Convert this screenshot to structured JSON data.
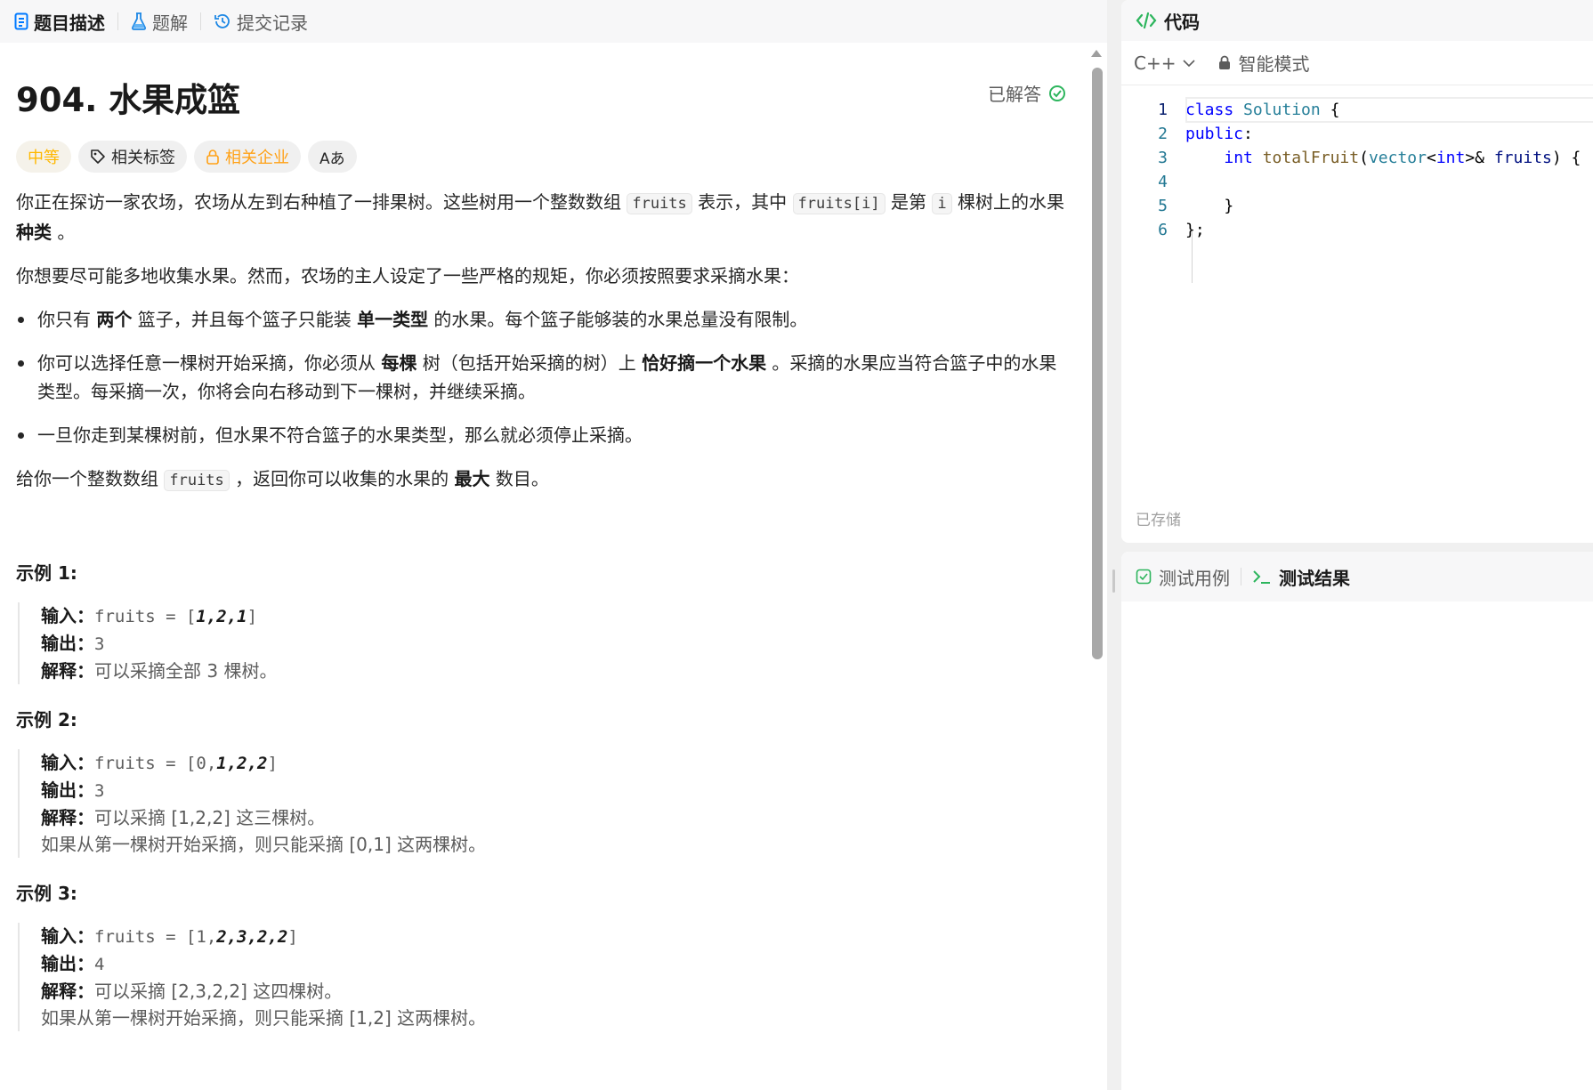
{
  "left_tabs": {
    "description": "题目描述",
    "solution": "题解",
    "submissions": "提交记录"
  },
  "problem": {
    "title": "904. 水果成篮",
    "status": "已解答",
    "tags": {
      "difficulty": "中等",
      "related_tags": "相关标签",
      "related_companies": "相关企业",
      "translate": "Aあ"
    }
  },
  "description": {
    "p1": [
      "你正在探访一家农场，农场从左到右种植了一排果树。这些树用一个整数数组 ",
      "fruits",
      " 表示，其中 ",
      "fruits[i]",
      " 是第 ",
      "i",
      " 棵树上的水果 ",
      "种类",
      " 。"
    ],
    "p2": "你想要尽可能多地收集水果。然而，农场的主人设定了一些严格的规矩，你必须按照要求采摘水果：",
    "rule1": [
      "你只有 ",
      "两个",
      " 篮子，并且每个篮子只能装 ",
      "单一类型",
      " 的水果。每个篮子能够装的水果总量没有限制。"
    ],
    "rule2": [
      "你可以选择任意一棵树开始采摘，你必须从 ",
      "每棵",
      " 树（包括开始采摘的树）上 ",
      "恰好摘一个水果",
      " 。采摘的水果应当符合篮子中的水果类型。每采摘一次，你将会向右移动到下一棵树，并继续采摘。"
    ],
    "rule3": "一旦你走到某棵树前，但水果不符合篮子的水果类型，那么就必须停止采摘。",
    "p3": [
      "给你一个整数数组 ",
      "fruits",
      " ，返回你可以收集的水果的 ",
      "最大",
      " 数目。"
    ]
  },
  "examples": [
    {
      "title": "示例 1:",
      "input_label": "输入：",
      "input_prefix": "fruits = [",
      "input_plain": "",
      "input_bold": "1,2,1",
      "input_suffix": "]",
      "output_label": "输出：",
      "output": "3",
      "explain_label": "解释：",
      "explain": "可以采摘全部 3 棵树。",
      "explain2": ""
    },
    {
      "title": "示例 2:",
      "input_label": "输入：",
      "input_prefix": "fruits = [",
      "input_plain": "0,",
      "input_bold": "1,2,2",
      "input_suffix": "]",
      "output_label": "输出：",
      "output": "3",
      "explain_label": "解释：",
      "explain": "可以采摘 [1,2,2] 这三棵树。",
      "explain2": "如果从第一棵树开始采摘，则只能采摘 [0,1] 这两棵树。"
    },
    {
      "title": "示例 3:",
      "input_label": "输入：",
      "input_prefix": "fruits = [",
      "input_plain": "1,",
      "input_bold": "2,3,2,2",
      "input_suffix": "]",
      "output_label": "输出：",
      "output": "4",
      "explain_label": "解释：",
      "explain": "可以采摘 [2,3,2,2] 这四棵树。",
      "explain2": "如果从第一棵树开始采摘，则只能采摘 [1,2] 这两棵树。"
    }
  ],
  "code_panel": {
    "title": "代码",
    "language": "C++",
    "mode": "智能模式",
    "saved": "已存储",
    "line_numbers": [
      "1",
      "2",
      "3",
      "4",
      "5",
      "6"
    ]
  },
  "test_panel": {
    "testcase_tab": "测试用例",
    "result_tab": "测试结果"
  },
  "colors": {
    "accent_green": "#2db55d",
    "difficulty_yellow": "#ffb800",
    "company_orange": "#ffa116",
    "tab_blue": "#007aff"
  }
}
